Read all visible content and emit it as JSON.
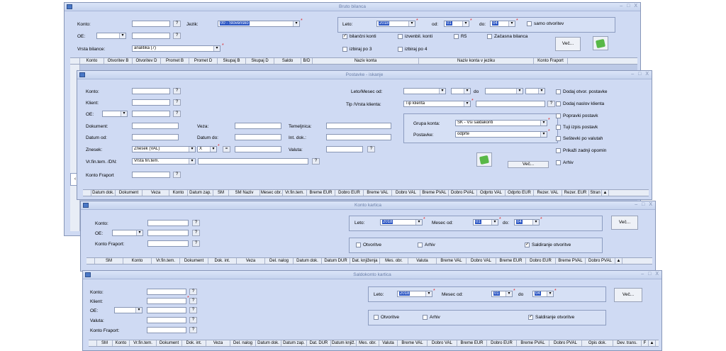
{
  "bruto": {
    "title": "Bruto bilanca",
    "controls": [
      "–",
      "□",
      "X"
    ],
    "labels": {
      "konto": "Konto:",
      "jezik": "Jezik:",
      "oe": "OE:",
      "vrsta": "Vrsta bilance:",
      "leto": "Leto:",
      "od": "od:",
      "do": "do:"
    },
    "jezik_value": "00 - Slovensko",
    "vrsta_value": "analitika (7)",
    "leto_value": "2018",
    "od_value": "01",
    "do_value": "04",
    "checks": {
      "samo_otvoritev": "samo otvoritev",
      "bilancni": "bilančni konti",
      "izvenbil": "izvenbil. konti",
      "r5": "R5",
      "zacasna": "Začasna bilanca",
      "izbiraj3": "izbiraj po 3",
      "izbiraj4": "izbiraj po 4"
    },
    "vec": "Več...",
    "columns": [
      "Konto",
      "Otvoritev B",
      "Otvoritev D",
      "Promet B",
      "Promet D",
      "Skupaj B",
      "Skupaj D",
      "Saldo",
      "B/D",
      "Naziv konta",
      "Naziv konta v jeziku",
      "Konto Fraport"
    ]
  },
  "postavke": {
    "title": "Postavke - iskanje",
    "controls": [
      "–",
      "□",
      "X"
    ],
    "labels": {
      "konto": "Konto:",
      "klient": "Klient:",
      "oe": "OE:",
      "dokument": "Dokument:",
      "datumod": "Datum od:",
      "znesek": "Znesek:",
      "vrfin": "Vr.fin.tem. /DN:",
      "kontofraport": "Konto Fraport",
      "veza": "Veza:",
      "datumdo": "Datum do:",
      "temeljnica": "Temeljnica:",
      "intdok": "Int. dok.:",
      "valuta": "Valuta:",
      "letomesec": "Leto/Mesec od:",
      "do": "do",
      "tip": "Tip /Vrsta klienta:",
      "grupa": "Grupa konta:",
      "postavke": "Postavke:"
    },
    "znesek_value": "Znesek (VAL)",
    "x_value": "X",
    "eq_value": "=",
    "vrfin_value": "Vrsta fin.tem.",
    "tip_value": "Tip klienta",
    "grupa_value": "SK - Vsi saldakonti",
    "postavke_value": "odprte",
    "checks": [
      "Dodaj otvor. postavke",
      "Dodaj naslov klienta",
      "Popravki postavk",
      "Tuji izpis postavk",
      "Seštevki po valutah",
      "Prikaži zadnji opomin",
      "Arhiv"
    ],
    "vec": "Več...",
    "columns": [
      "Datum dok.",
      "Dokument",
      "Veza",
      "Konto",
      "Datum zap.",
      "SM",
      "SM Naziv",
      "Mesec obr.",
      "Vr.fin.tem.",
      "Breme EUR",
      "Dobro EUR",
      "Breme VAL",
      "Dobro VAL",
      "Breme PVAL",
      "Dobro PVAL",
      "Odprto VAL",
      "Odprto EUR",
      "Rezer. VAL",
      "Rezer. EUR",
      "Stran"
    ]
  },
  "kartica": {
    "title": "Konto kartica",
    "controls": [
      "–",
      "□",
      "X"
    ],
    "labels": {
      "konto": "Konto:",
      "oe": "OE:",
      "kontofraport": "Konto Fraport:",
      "leto": "Leto:",
      "mesec": "Mesec od:",
      "do": "do:"
    },
    "leto_value": "2018",
    "od_value": "01",
    "do_value": "04",
    "checks": {
      "otvoritve": "Otvoritve",
      "arhiv": "Arhiv",
      "saldiranje": "Saldiranje otvoritve"
    },
    "vec": "Več...",
    "columns": [
      "SM",
      "Konto",
      "Vr.fin.tem.",
      "Dokument",
      "Dok. int.",
      "Veza",
      "Del. nalog",
      "Datum dok.",
      "Datum DUR",
      "Dat. knjiženja",
      "Mes. obr.",
      "Valuta",
      "Breme VAL",
      "Dobro VAL",
      "Breme EUR",
      "Dobro EUR",
      "Breme PVAL",
      "Dobro PVAL"
    ]
  },
  "saldokonto": {
    "title": "Saldokonto kartica",
    "controls": [
      "–",
      "□",
      "X"
    ],
    "labels": {
      "konto": "Konto:",
      "klient": "Klient:",
      "oe": "OE:",
      "valuta": "Valuta:",
      "kontofraport": "Konto Fraport:",
      "leto": "Leto:",
      "mesec": "Mesec od:",
      "do": "do"
    },
    "leto_value": "2018",
    "od_value": "01",
    "do_value": "04",
    "checks": {
      "otvoritve": "Otvoritve",
      "arhiv": "Arhiv",
      "saldiranje": "Saldiranje otvoritve"
    },
    "vec": "Več...",
    "columns": [
      "SM",
      "Konto",
      "Vr.fin.tem.",
      "Dokument",
      "Dok. int.",
      "Veza",
      "Del. nalog",
      "Datum dok.",
      "Datum zap.",
      "Dat. DUR",
      "Datum knjiž.",
      "Mes. obr.",
      "Valuta",
      "Breme VAL",
      "Dobro VAL",
      "Breme EUR",
      "Dobro EUR",
      "Breme PVAL",
      "Dobro PVAL",
      "Opis dok.",
      "Dev. trans.",
      "F"
    ]
  }
}
